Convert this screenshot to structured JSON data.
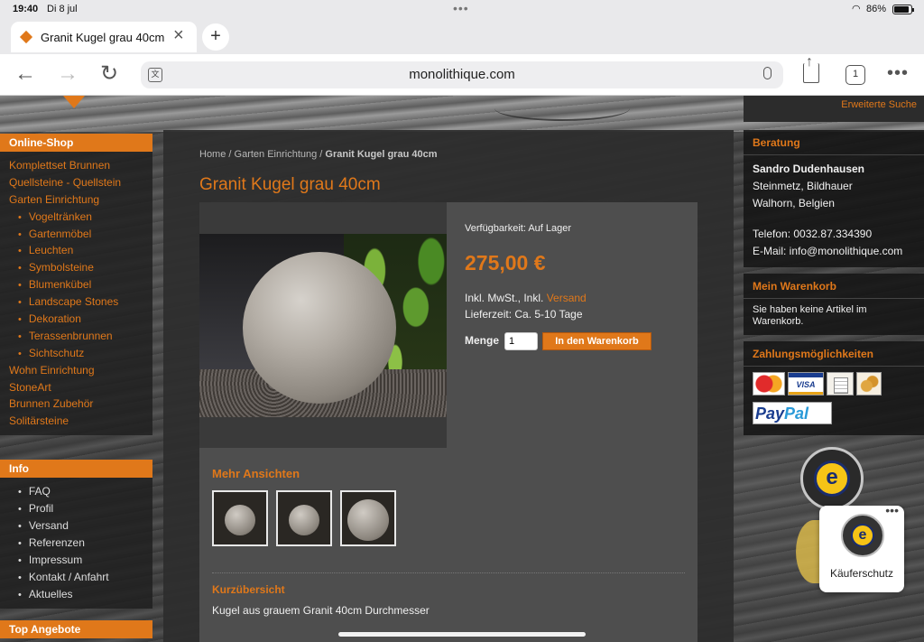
{
  "status": {
    "time": "19:40",
    "date": "Di 8 jul",
    "battery": "86%"
  },
  "tab": {
    "title": "Granit Kugel grau 40cm"
  },
  "toolbar": {
    "url": "monolithique.com",
    "tab_count": "1"
  },
  "header": {
    "advanced_search": "Erweiterte Suche"
  },
  "sidebar": {
    "shop_title": "Online-Shop",
    "shop_items": [
      "Komplettset Brunnen",
      "Quellsteine - Quellstein",
      "Garten Einrichtung",
      "Vogeltränken",
      "Gartenmöbel",
      "Leuchten",
      "Symbolsteine",
      "Blumenkübel",
      "Landscape Stones",
      "Dekoration",
      "Terassenbrunnen",
      "Sichtschutz",
      "Wohn Einrichtung",
      "StoneArt",
      "Brunnen Zubehör",
      "Solitärsteine"
    ],
    "info_title": "Info",
    "info_items": [
      "FAQ",
      "Profil",
      "Versand",
      "Referenzen",
      "Impressum",
      "Kontakt / Anfahrt",
      "Aktuelles"
    ],
    "top_title": "Top Angebote"
  },
  "main": {
    "breadcrumb": {
      "home": "Home",
      "sep": " / ",
      "category": "Garten Einrichtung",
      "current": "Granit Kugel grau 40cm"
    },
    "title": "Granit Kugel grau 40cm",
    "availability": "Verfügbarkeit: Auf Lager",
    "price": "275,00 €",
    "tax_prefix": "Inkl. MwSt., Inkl. ",
    "tax_link": "Versand",
    "delivery": "Lieferzeit: Ca. 5-10 Tage",
    "qty_label": "Menge",
    "qty_value": "1",
    "cart_button": "In den Warenkorb",
    "more_views": "Mehr Ansichten",
    "short_title": "Kurzübersicht",
    "short_text": "Kugel aus grauem Granit 40cm Durchmesser"
  },
  "right": {
    "advice_title": "Beratung",
    "advice_name": "Sandro Dudenhausen",
    "advice_role": "Steinmetz, Bildhauer",
    "advice_place": "Walhorn, Belgien",
    "advice_phone": "Telefon: 0032.87.334390",
    "advice_email_prefix": "E-Mail: ",
    "advice_email": "info@monolithique.com",
    "cart_title": "Mein Warenkorb",
    "cart_text": "Sie haben keine Artikel im Warenkorb.",
    "payment_title": "Zahlungsmöglichkeiten",
    "visa": "VISA",
    "paypal_pay": "Pay",
    "paypal_pal": "Pal"
  },
  "widget": {
    "label": "Käuferschutz",
    "seal_letter": "e"
  },
  "colors": {
    "accent": "#e0781a",
    "panel": "#2d2d2d"
  }
}
